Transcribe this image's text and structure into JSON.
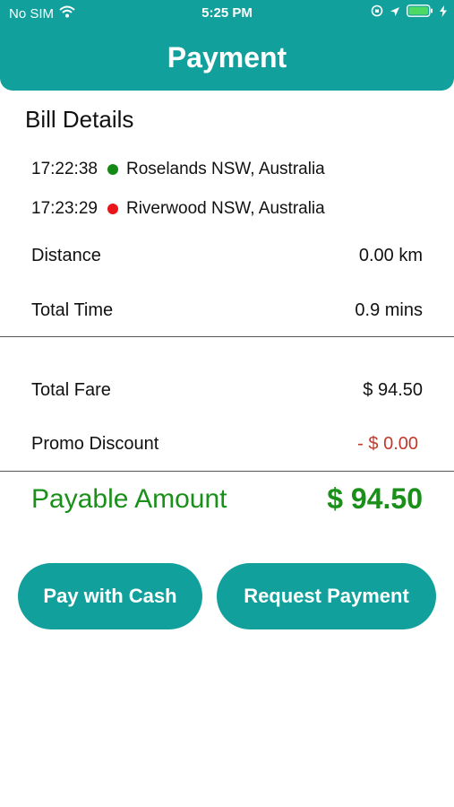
{
  "status_bar": {
    "carrier": "No SIM",
    "time": "5:25 PM",
    "icons": [
      "wifi-icon",
      "orientation-lock-icon",
      "location-arrow-icon",
      "battery-icon",
      "charging-bolt-icon"
    ]
  },
  "header": {
    "title": "Payment"
  },
  "bill": {
    "title": "Bill Details",
    "pickup": {
      "time": "17:22:38",
      "address": "Roselands NSW, Australia",
      "dot_color": "#138a13"
    },
    "dropoff": {
      "time": "17:23:29",
      "address": "Riverwood NSW, Australia",
      "dot_color": "#e8161b"
    },
    "distance": {
      "label": "Distance",
      "value": "0.00 km"
    },
    "total_time": {
      "label": "Total Time",
      "value": "0.9 mins"
    },
    "total_fare": {
      "label": "Total Fare",
      "value": "$ 94.50"
    },
    "promo": {
      "label": "Promo Discount",
      "value": "- $ 0.00",
      "color": "#c0392b"
    },
    "payable": {
      "label": "Payable Amount",
      "value": "$ 94.50",
      "color": "#1a8f1a"
    }
  },
  "actions": {
    "cash_label": "Pay with Cash",
    "request_label": "Request Payment",
    "accent": "#12a09c"
  }
}
